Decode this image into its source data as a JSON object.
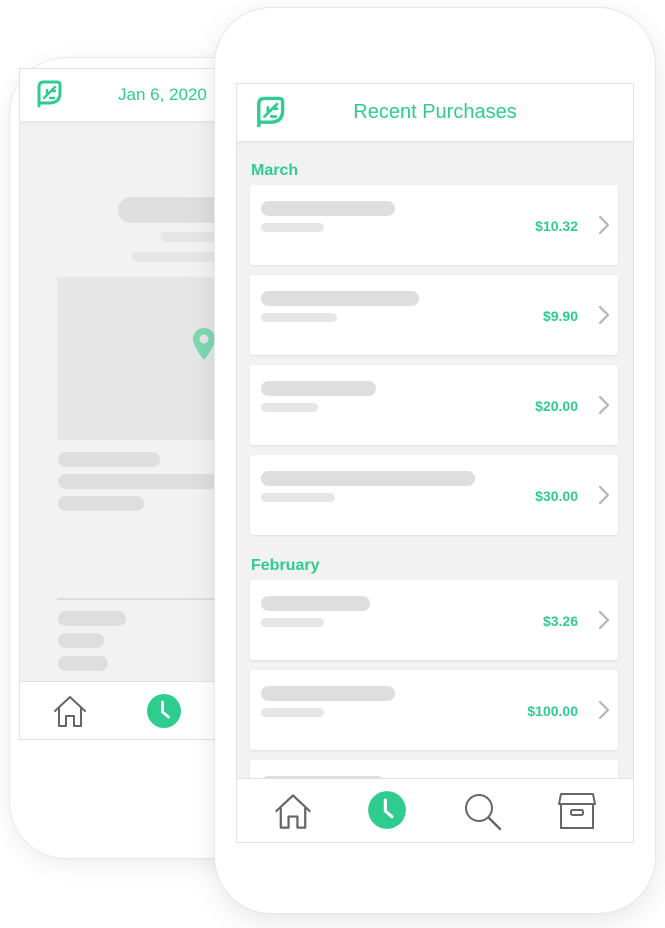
{
  "back_screen": {
    "header": {
      "date": "Jan 6, 2020",
      "logo_icon": "leaf-icon"
    },
    "map_pin_icon": "location-pin-icon",
    "tabs": [
      {
        "icon": "home-icon",
        "active": false
      },
      {
        "icon": "clock-icon",
        "active": true
      }
    ]
  },
  "front_screen": {
    "header": {
      "title": "Recent Purchases",
      "logo_icon": "leaf-icon"
    },
    "sections": [
      {
        "label": "March",
        "items": [
          {
            "price": "$10.32"
          },
          {
            "price": "$9.90"
          },
          {
            "price": "$20.00"
          },
          {
            "price": "$30.00"
          }
        ]
      },
      {
        "label": "February",
        "items": [
          {
            "price": "$3.26"
          },
          {
            "price": "$100.00"
          }
        ]
      }
    ],
    "tabs": [
      {
        "icon": "home-icon",
        "active": false
      },
      {
        "icon": "clock-icon",
        "active": true
      },
      {
        "icon": "search-icon",
        "active": false
      },
      {
        "icon": "archive-box-icon",
        "active": false
      }
    ]
  },
  "colors": {
    "accent": "#2ecc8e",
    "skeleton": "#dedede",
    "background": "#f2f2f2"
  }
}
